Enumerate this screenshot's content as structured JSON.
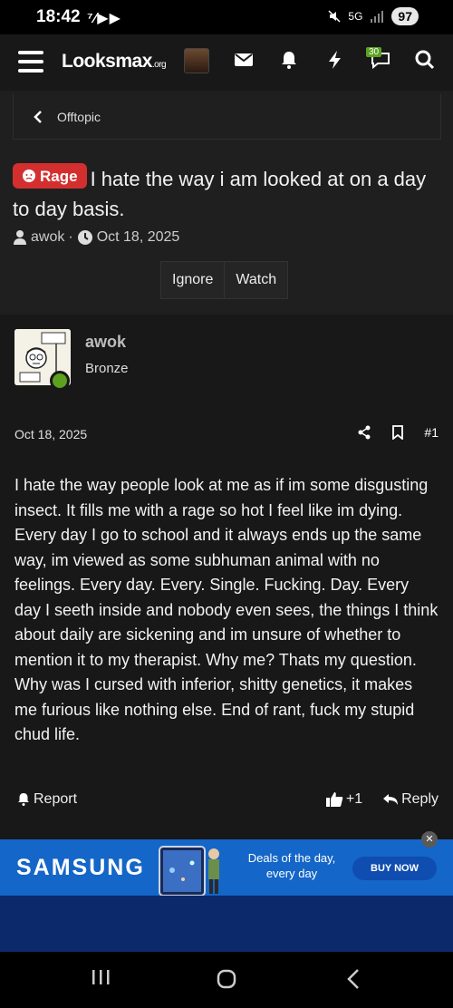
{
  "status": {
    "time": "18:42",
    "apps": "⁷⁄▶▶",
    "network": "5G",
    "battery": "97"
  },
  "nav": {
    "logo_main": "Looksmax",
    "logo_tld": ".org",
    "notif_count": "30"
  },
  "breadcrumb": {
    "label": "Offtopic"
  },
  "thread": {
    "prefix": "Rage",
    "title": "I hate the way i am looked at on a day to day basis.",
    "author": "awok",
    "separator": "·",
    "date": "Oct 18, 2025",
    "ignore_label": "Ignore",
    "watch_label": "Watch"
  },
  "post": {
    "username": "awok",
    "user_title": "Bronze",
    "date": "Oct 18, 2025",
    "number": "#1",
    "body": "I hate the way people look at me as if im some disgusting insect. It fills me with a rage so hot I feel like im dying. Every day I go to school and it always ends up the same way, im viewed as some subhuman animal with no feelings. Every day. Every. Single. Fucking. Day. Every day I seeth inside and nobody even sees, the things I think about daily are sickening and im unsure of whether to mention it to my therapist. Why me? Thats my question. Why was I cursed with inferior, shitty genetics, it makes me furious like nothing else. End of rant, fuck my stupid chud life.",
    "report_label": "Report",
    "like_count": "+1",
    "reply_label": "Reply"
  },
  "ad": {
    "brand": "SAMSUNG",
    "text": "Deals of the day, every day",
    "cta": "BUY NOW",
    "close": "✕"
  },
  "colors": {
    "accent": "#5ca21f",
    "prefix": "#d32f2f",
    "ad_bg": "#1466c8"
  },
  "icons": [
    "hamburger-icon",
    "mail-icon",
    "bell-icon",
    "bolt-icon",
    "chat-icon",
    "search-icon",
    "chevron-left-icon",
    "user-icon",
    "clock-icon",
    "share-icon",
    "bookmark-icon",
    "bell-report-icon",
    "thumbs-up-icon",
    "reply-icon",
    "close-icon"
  ]
}
